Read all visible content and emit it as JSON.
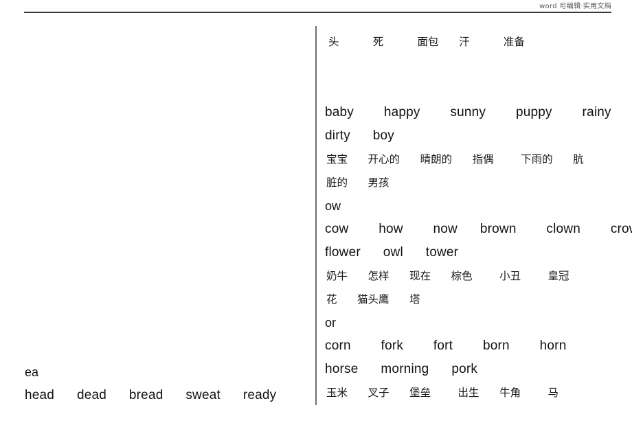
{
  "header": {
    "watermark": "word 可编辑·实用文档"
  },
  "left_column": {
    "groups": [
      {
        "pattern": "ea",
        "words_lines": [
          "head      dead      bread      sweat      ready"
        ],
        "translation_lines": []
      }
    ]
  },
  "right_column": {
    "orphan_translation_line": "头          死          面包      汗          准备",
    "groups": [
      {
        "pattern": "",
        "words_lines": [
          "baby        happy        sunny        puppy        rainy",
          "dirty      boy"
        ],
        "translation_lines": [
          "宝宝      开心的      晴朗的      指偶        下雨的      肮",
          "脏的      男孩"
        ]
      },
      {
        "pattern": "ow",
        "words_lines": [
          "cow        how        now      brown        clown        crown",
          "flower      owl      tower"
        ],
        "translation_lines": [
          "奶牛      怎样      现在      棕色        小丑        皇冠",
          "花      猫头鹰      塔"
        ]
      },
      {
        "pattern": "or",
        "words_lines": [
          "corn        fork        fort        born        horn",
          "horse      morning      pork"
        ],
        "translation_lines": [
          "玉米      叉子      堡垒        出生      牛角        马"
        ]
      }
    ]
  },
  "words_flat": {
    "ea": [
      "head",
      "dead",
      "bread",
      "sweat",
      "ready"
    ],
    "y_ending": [
      "baby",
      "happy",
      "sunny",
      "puppy",
      "rainy",
      "dirty",
      "boy"
    ],
    "ow": [
      "cow",
      "how",
      "now",
      "brown",
      "clown",
      "crown",
      "flower",
      "owl",
      "tower"
    ],
    "or": [
      "corn",
      "fork",
      "fort",
      "born",
      "horn",
      "horse",
      "morning",
      "pork"
    ]
  },
  "translations_flat": {
    "previous_page": [
      "头",
      "死",
      "面包",
      "汗",
      "准备"
    ],
    "y_ending": [
      "宝宝",
      "开心的",
      "晴朗的",
      "指偶",
      "下雨的",
      "肮脏的",
      "男孩"
    ],
    "ow": [
      "奶牛",
      "怎样",
      "现在",
      "棕色",
      "小丑",
      "皇冠",
      "花",
      "猫头鹰",
      "塔"
    ],
    "or": [
      "玉米",
      "叉子",
      "堡垒",
      "出生",
      "牛角",
      "马"
    ]
  },
  "colors": {
    "text": "#111111",
    "rule": "#3a3a3a",
    "divider": "#6e6e6e",
    "watermark": "#555555",
    "page": "#ffffff"
  }
}
